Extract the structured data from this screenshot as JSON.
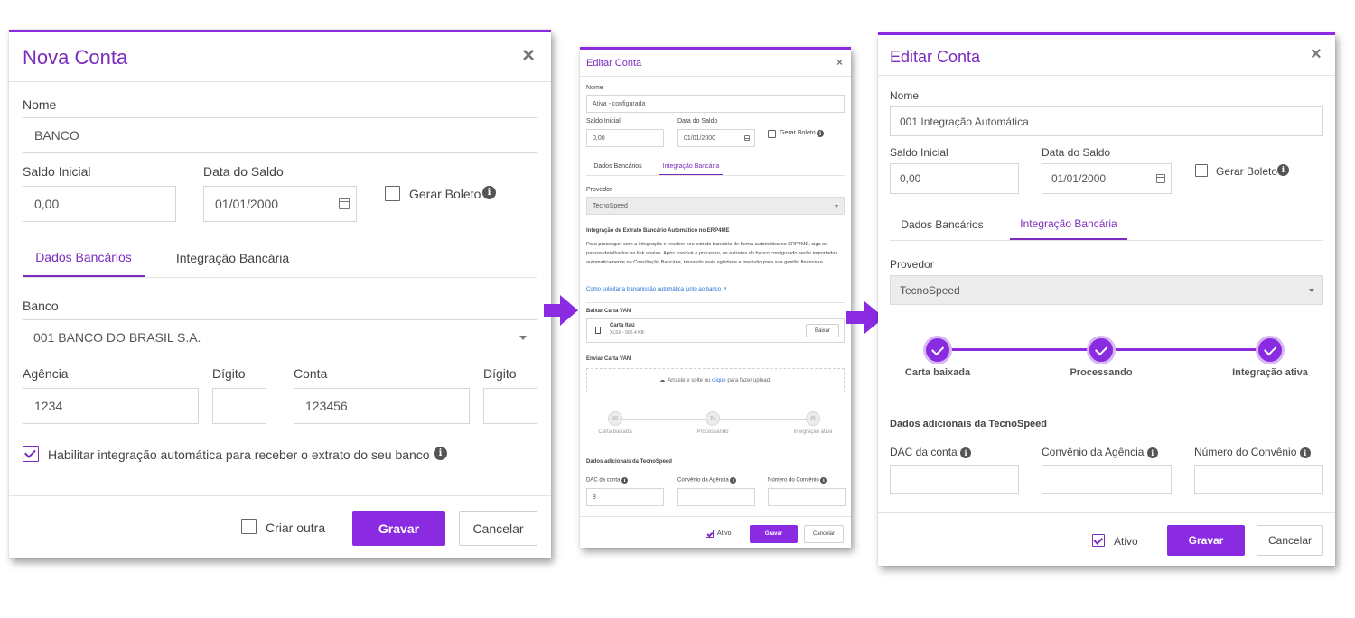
{
  "modal1": {
    "title": "Nova Conta",
    "close_icon": "×",
    "nome_label": "Nome",
    "nome_value": "BANCO",
    "saldo_label": "Saldo Inicial",
    "saldo_value": "0,00",
    "data_label": "Data do Saldo",
    "data_value": "01/01/2000",
    "gerar_boleto": "Gerar Boleto",
    "tabs": [
      "Dados Bancários",
      "Integração Bancária"
    ],
    "banco_label": "Banco",
    "banco_value": "001 BANCO DO BRASIL S.A.",
    "agencia_label": "Agência",
    "agencia_value": "1234",
    "digito_label": "Dígito",
    "conta_label": "Conta",
    "conta_value": "123456",
    "digito2_label": "Dígito",
    "habilitar_label": "Habilitar integração automática para receber o extrato do seu banco",
    "criar_outra": "Criar outra",
    "gravar": "Gravar",
    "cancelar": "Cancelar"
  },
  "modal2": {
    "title": "Editar Conta",
    "close_icon": "×",
    "nome_label": "Nome",
    "nome_value": "Ativa - configurada",
    "saldo_label": "Saldo Inicial",
    "saldo_value": "0,00",
    "data_label": "Data do Saldo",
    "data_value": "01/01/2000",
    "gerar_boleto": "Gerar Boleto",
    "tabs": [
      "Dados Bancários",
      "Integração Bancária"
    ],
    "provedor_label": "Provedor",
    "provedor_value": "TecnoSpeed",
    "integracao_title": "Integração de Extrato Bancário Automático no ERP4ME",
    "integracao_text": "Para prosseguir com a integração e receber seu extrato bancário de forma automática no ERP4ME, siga os passos detalhados no link abaixo. Após concluir o processo, os extratos do banco configurado serão importados automaticamente na Conciliação Bancária, trazendo mais agilidade e precisão para sua gestão financeira.",
    "link_text": "Como solicitar a transmissão automática junto ao banco",
    "baixar_title": "Baixar Carta VAN",
    "file_name": "Carta Itaú",
    "file_meta": "XLSX - 506.4 KB",
    "baixar_button": "Baixar",
    "enviar_title": "Enviar Carta VAN",
    "upload_pre": "Arraste e solte ou",
    "upload_link": "clique",
    "upload_post": "para fazer upload.",
    "steps": [
      "Carta baixada",
      "Processando",
      "Integração ativa"
    ],
    "dados_title": "Dados adicionais da TecnoSpeed",
    "dac_label": "DAC da conta",
    "dac_value": "8",
    "convenio_agencia_label": "Convênio da Agência",
    "numero_convenio_label": "Número do Convênio",
    "ativo": "Ativo",
    "gravar": "Gravar",
    "cancelar": "Cancelar"
  },
  "modal3": {
    "title": "Editar Conta",
    "close_icon": "×",
    "nome_label": "Nome",
    "nome_value": "001 Integração Automática",
    "saldo_label": "Saldo Inicial",
    "saldo_value": "0,00",
    "data_label": "Data do Saldo",
    "data_value": "01/01/2000",
    "gerar_boleto": "Gerar Boleto",
    "tabs": [
      "Dados Bancários",
      "Integração Bancária"
    ],
    "provedor_label": "Provedor",
    "provedor_value": "TecnoSpeed",
    "steps": [
      "Carta baixada",
      "Processando",
      "Integração ativa"
    ],
    "dados_title": "Dados adicionais da TecnoSpeed",
    "dac_label": "DAC da conta",
    "convenio_agencia_label": "Convênio da Agência",
    "numero_convenio_label": "Número do Convênio",
    "ativo": "Ativo",
    "gravar": "Gravar",
    "cancelar": "Cancelar"
  },
  "colors": {
    "accent": "#8a2be2",
    "title": "#7b2cbf"
  },
  "icons": [
    "close-icon",
    "calendar-icon",
    "info-icon",
    "chevron-down-icon",
    "arrow-right-icon",
    "check-icon",
    "file-icon",
    "cloud-upload-icon",
    "external-link-icon"
  ]
}
